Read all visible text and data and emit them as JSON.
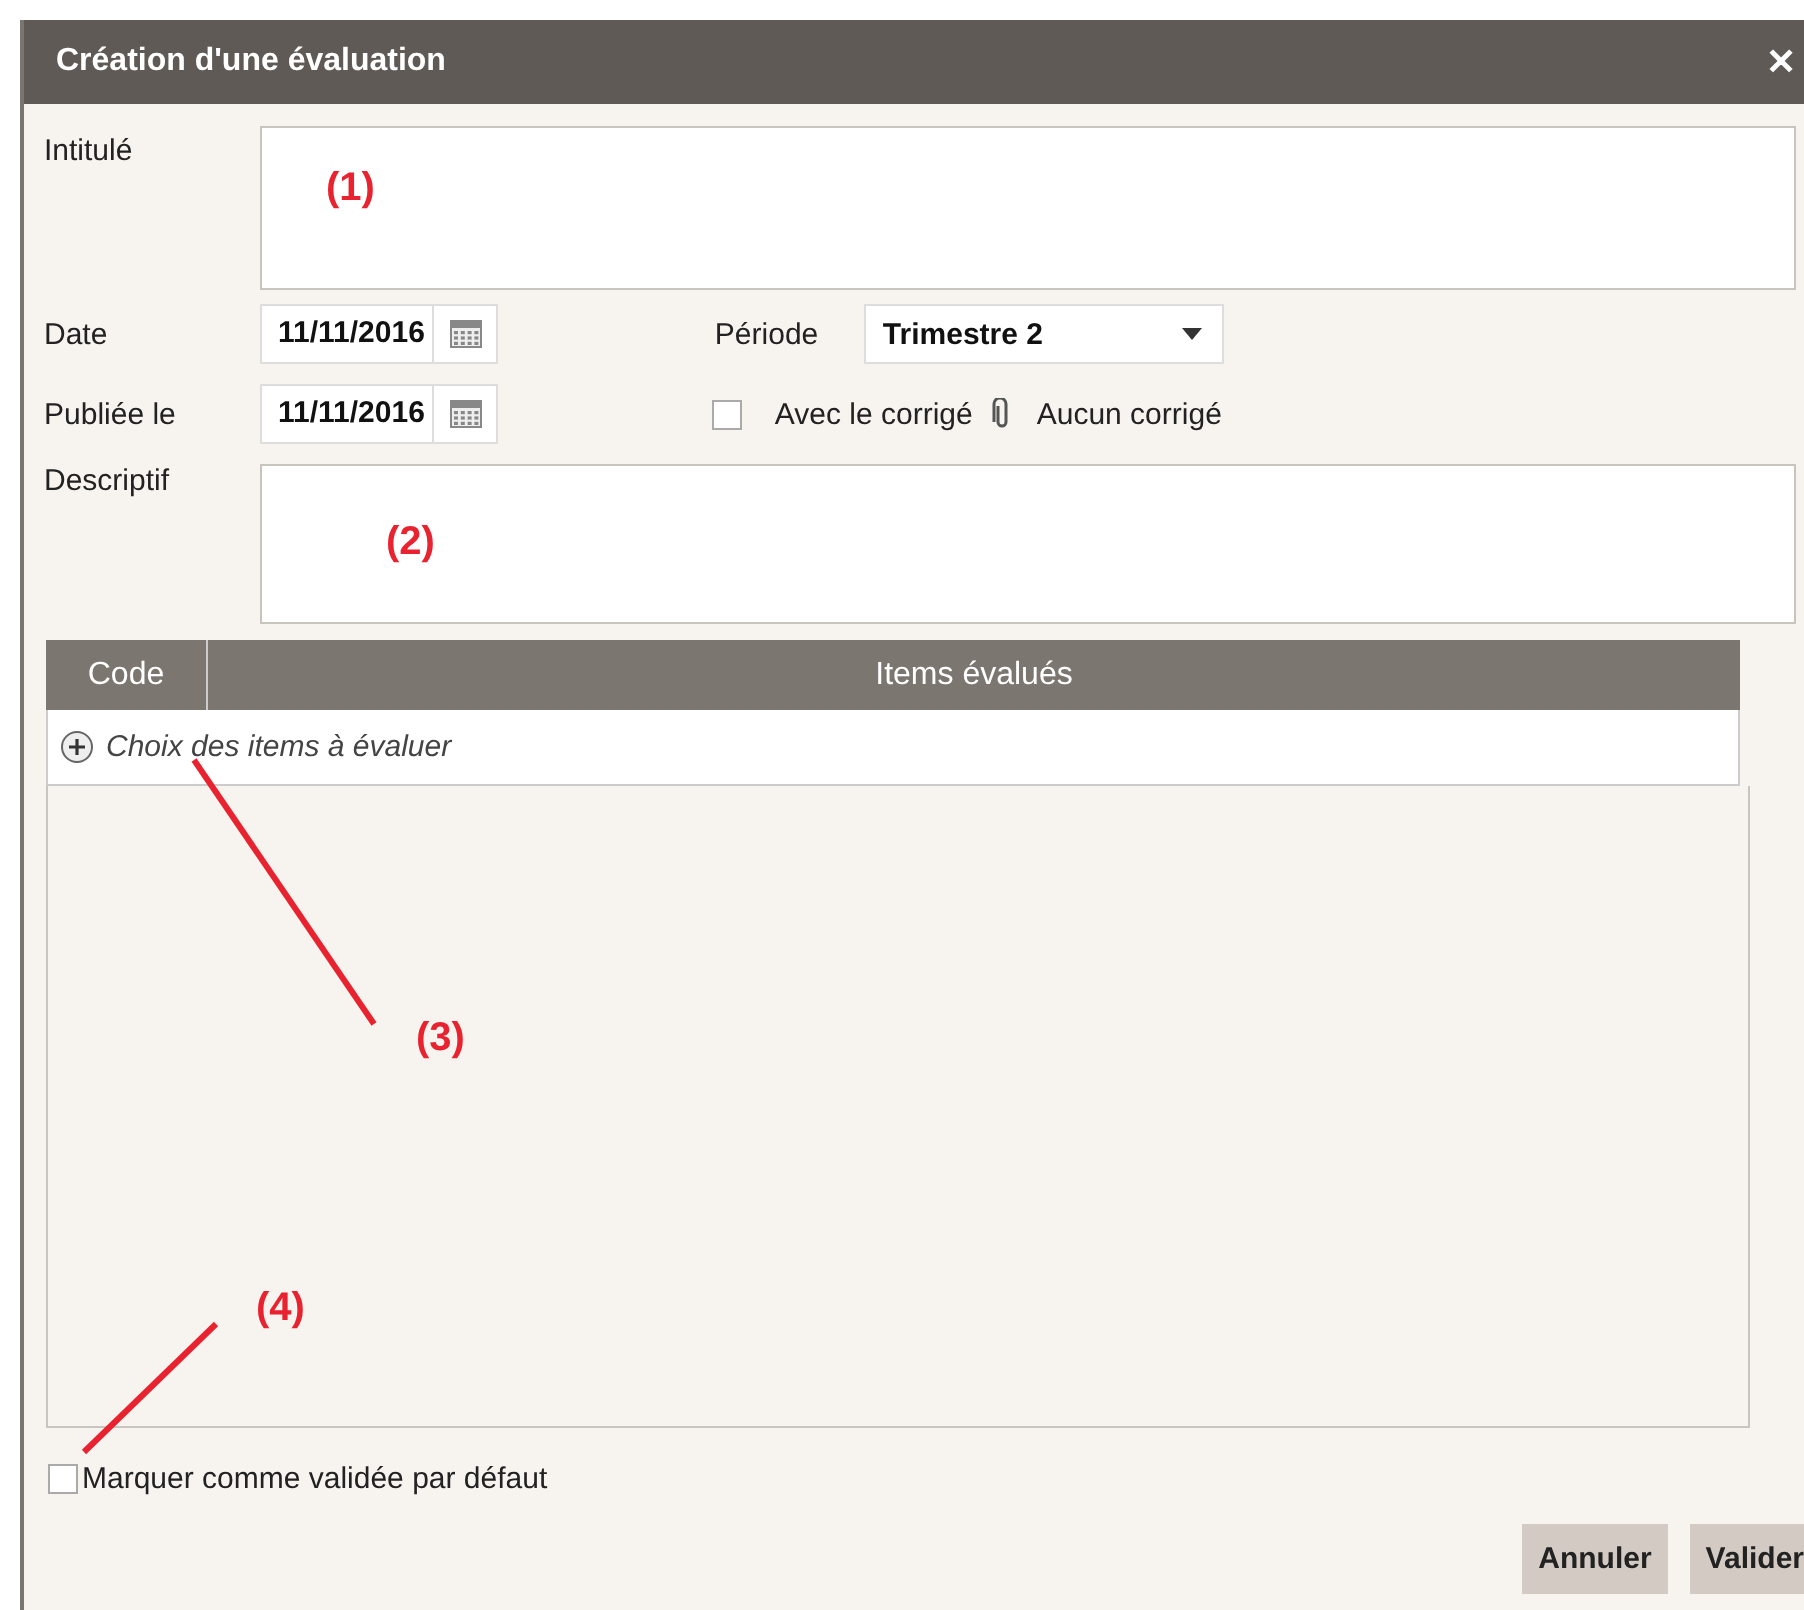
{
  "window": {
    "title": "Création d'une évaluation",
    "close": "✕"
  },
  "fields": {
    "intitule": {
      "label": "Intitulé"
    },
    "date": {
      "label": "Date",
      "value": "11/11/2016"
    },
    "publiee": {
      "label": "Publiée le",
      "value": "11/11/2016"
    },
    "descriptif": {
      "label": "Descriptif"
    }
  },
  "periode": {
    "label": "Période",
    "value": "Trimestre 2"
  },
  "corrige": {
    "label": "Avec le corrigé",
    "checked": false,
    "attachment": "Aucun corrigé"
  },
  "table": {
    "columns": [
      "Code",
      "Items évalués"
    ],
    "add_row": "Choix des items à évaluer"
  },
  "validated_default": {
    "label": "Marquer comme validée par défaut",
    "checked": false
  },
  "buttons": [
    "Annuler",
    "Valider"
  ],
  "annotations": [
    {
      "text": "(1)"
    },
    {
      "text": "(2)"
    },
    {
      "text": "(3)"
    },
    {
      "text": "(4)"
    }
  ]
}
